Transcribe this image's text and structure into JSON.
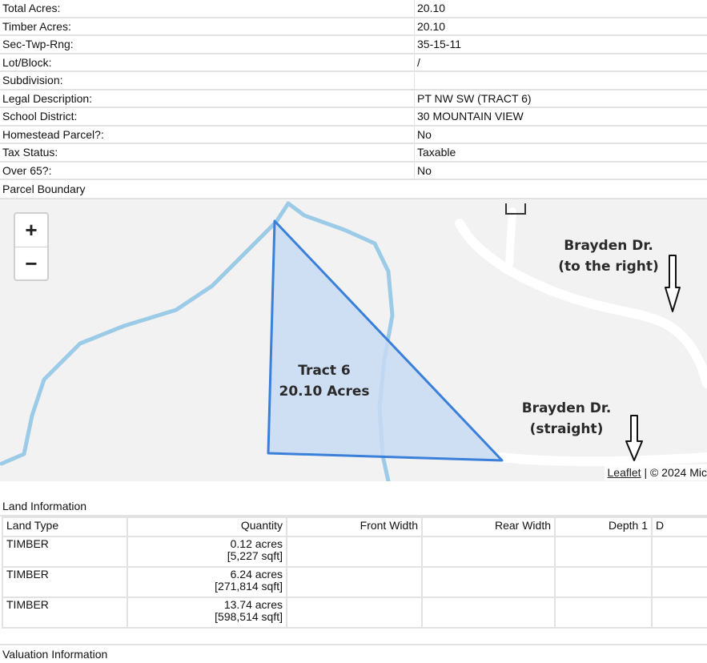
{
  "property": [
    {
      "label": "Total Acres:",
      "value": "20.10"
    },
    {
      "label": "Timber Acres:",
      "value": "20.10"
    },
    {
      "label": "Sec-Twp-Rng:",
      "value": "35-15-11"
    },
    {
      "label": "Lot/Block:",
      "value": "/"
    },
    {
      "label": "Subdivision:",
      "value": ""
    },
    {
      "label": "Legal Description:",
      "value": "PT NW SW (TRACT 6)"
    },
    {
      "label": "School District:",
      "value": "30 MOUNTAIN VIEW"
    },
    {
      "label": "Homestead Parcel?:",
      "value": "No"
    },
    {
      "label": "Tax Status:",
      "value": "Taxable"
    },
    {
      "label": "Over 65?:",
      "value": "No"
    }
  ],
  "parcel_boundary": {
    "title": "Parcel Boundary",
    "zoom_in": "+",
    "zoom_out": "−",
    "tract_label_line1": "Tract 6",
    "tract_label_line2": "20.10 Acres",
    "road1_line1": "Brayden Dr.",
    "road1_line2": "(to the right)",
    "road2_line1": "Brayden Dr.",
    "road2_line2": "(straight)",
    "attribution_link": "Leaflet",
    "attribution_text": " | © 2024 Mic",
    "colors": {
      "parcel_stroke": "#3a7fd9",
      "parcel_fill": "#c8daf3",
      "stream": "#9ccbe8",
      "road": "#ffffff",
      "map_bg": "#f2f2f2"
    }
  },
  "land_information": {
    "title": "Land Information",
    "headers": [
      "Land Type",
      "Quantity",
      "Front Width",
      "Rear Width",
      "Depth 1",
      "D"
    ],
    "rows": [
      {
        "type": "TIMBER",
        "acres": "0.12 acres",
        "sqft": "[5,227 sqft]"
      },
      {
        "type": "TIMBER",
        "acres": "6.24 acres",
        "sqft": "[271,814 sqft]"
      },
      {
        "type": "TIMBER",
        "acres": "13.74 acres",
        "sqft": "[598,514 sqft]"
      }
    ]
  },
  "valuation": {
    "title": "Valuation Information"
  }
}
